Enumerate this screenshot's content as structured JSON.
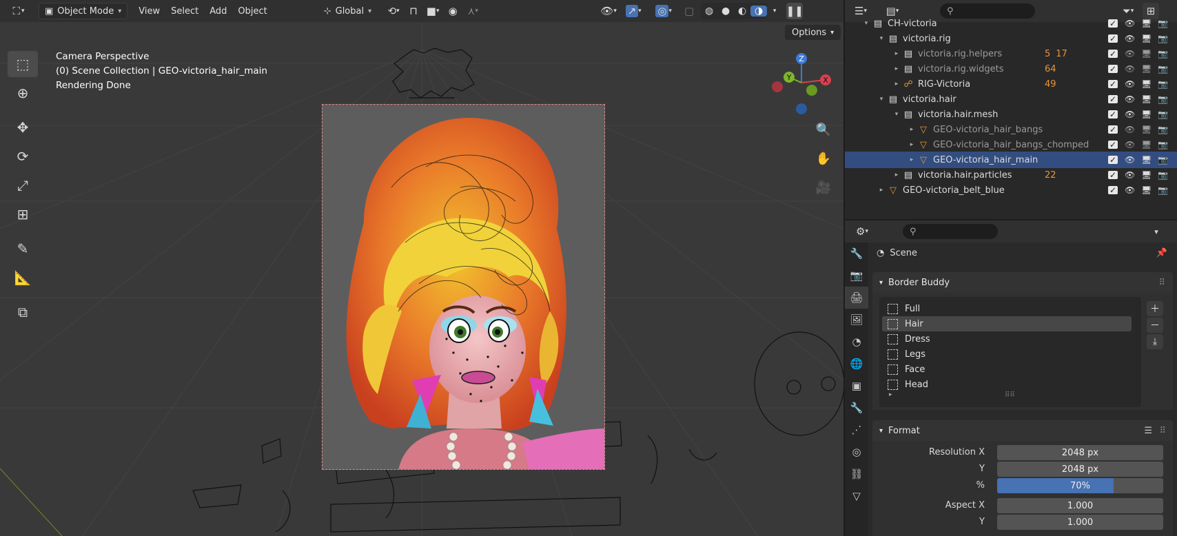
{
  "viewport_header": {
    "mode": "Object Mode",
    "menus": [
      "View",
      "Select",
      "Add",
      "Object"
    ],
    "orientation": "Global",
    "options": "Options"
  },
  "overlay": {
    "line1": "Camera Perspective",
    "line2": "(0) Scene Collection | GEO-victoria_hair_main",
    "line3": "Rendering Done"
  },
  "gizmo": {
    "z": "Z",
    "y": "Y",
    "x": "X"
  },
  "outliner": {
    "rows": [
      {
        "name": "CH-victoria",
        "indent": 0
      },
      {
        "name": "victoria.rig",
        "indent": 1
      },
      {
        "name": "victoria.rig.helpers",
        "indent": 2,
        "badges": [
          "5",
          "17"
        ]
      },
      {
        "name": "victoria.rig.widgets",
        "indent": 2,
        "badges": [
          "64"
        ]
      },
      {
        "name": "RIG-Victoria",
        "indent": 2,
        "badges": [
          "49"
        ]
      },
      {
        "name": "victoria.hair",
        "indent": 1
      },
      {
        "name": "victoria.hair.mesh",
        "indent": 2
      },
      {
        "name": "GEO-victoria_hair_bangs",
        "indent": 3
      },
      {
        "name": "GEO-victoria_hair_bangs_chomped",
        "indent": 3
      },
      {
        "name": "GEO-victoria_hair_main",
        "indent": 3
      },
      {
        "name": "victoria.hair.particles",
        "indent": 2,
        "badges": [
          "22"
        ]
      },
      {
        "name": "GEO-victoria_belt_blue",
        "indent": 1
      }
    ]
  },
  "properties": {
    "context": "Scene",
    "border_buddy": {
      "title": "Border Buddy",
      "items": [
        "Full",
        "Hair",
        "Dress",
        "Legs",
        "Face",
        "Head"
      ],
      "active": "Hair"
    },
    "format": {
      "title": "Format",
      "resolution_x_label": "Resolution X",
      "resolution_x": "2048 px",
      "resolution_y_label": "Y",
      "resolution_y": "2048 px",
      "percent_label": "%",
      "percent": "70%",
      "percent_value": 0.7,
      "aspect_x_label": "Aspect X",
      "aspect_x": "1.000",
      "aspect_y_label": "Y",
      "aspect_y": "1.000"
    }
  },
  "colors": {
    "accent": "#4772b3",
    "selection": "#334d80"
  }
}
